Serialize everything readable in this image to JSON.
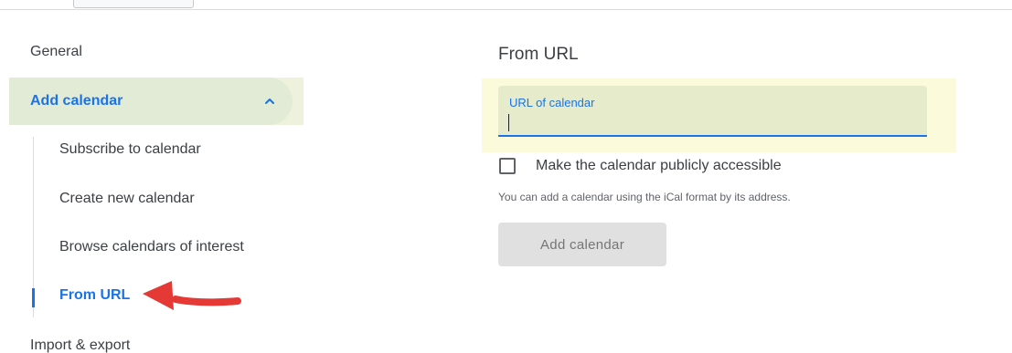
{
  "sidebar": {
    "general": "General",
    "add_calendar": "Add calendar",
    "add_calendar_sub": [
      "Subscribe to calendar",
      "Create new calendar",
      "Browse calendars of interest",
      "From URL"
    ],
    "import_export": "Import & export"
  },
  "main": {
    "title": "From URL",
    "url_field": {
      "label": "URL of calendar",
      "value": ""
    },
    "public_checkbox": {
      "label": "Make the calendar publicly accessible",
      "checked": false
    },
    "helper": "You can add a calendar using the iCal format by its address.",
    "add_button": "Add calendar"
  },
  "icons": {
    "collapse": "chevron-up-icon",
    "annotation": "red-arrow-icon"
  },
  "colors": {
    "accent": "#1a73e8",
    "text": "#3c4043",
    "highlight": "#fbfbdb",
    "annotation_arrow": "#e53935"
  }
}
